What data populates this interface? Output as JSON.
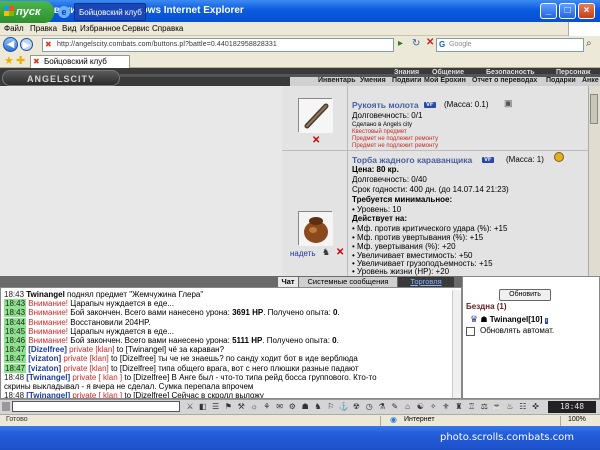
{
  "window": {
    "title": "Бойцовский клуб - Windows Internet Explorer"
  },
  "menu": {
    "items": [
      "Файл",
      "Правка",
      "Вид",
      "Избранное",
      "Сервис",
      "Справка"
    ]
  },
  "address": {
    "url": "http://angelscity.combats.com/buttons.pl?battle=0.440182958828331",
    "search_placeholder": "Google"
  },
  "tab": {
    "label": "Бойцовский клуб"
  },
  "game": {
    "logo": "ANGELSCITY",
    "nav_top": [
      "Знания",
      "Общение",
      "Безопасность",
      "Персонаж"
    ],
    "nav_bottom": [
      "Инвентарь",
      "Умения",
      "Подвиги",
      "Мой Ерохин",
      "Отчет о переводах",
      "Подарки",
      "Анке"
    ]
  },
  "items": [
    {
      "name": "Рукоять молота",
      "badge": "VF",
      "mass": "(Масса: 0.1)",
      "durability": "Долговечность: 0/1",
      "made_in": "Сделано в Angels city",
      "notes": [
        "Квестовый предмет",
        "Предмет не подлежит ремонту",
        "Предмет не подлежит ремонту"
      ]
    },
    {
      "name": "Торба жадного караванщика",
      "badge": "VF",
      "mass": "(Масса: 1)",
      "price": "Цена: 80 кр.",
      "durability": "Долговечность: 0/40",
      "expiry": "Срок годности: 400 дн. (до 14.07.14 21:23)",
      "req_title": "Требуется минимальное:",
      "req_level": "• Уровень: 10",
      "effects_title": "Действует на:",
      "effects": [
        "• Мф. против критического удара (%): +15",
        "• Мф. против увертывания (%): +15",
        "• Мф. увертывания (%): +20",
        "• Увеличивает вместимость: +50",
        "• Увеличивает грузоподъемность: +15",
        "• Уровень жизни (HP): +20"
      ],
      "action": "надеть"
    }
  ],
  "chat_tabs": [
    "Чат",
    "Системные сообщения",
    "Торговля"
  ],
  "chat": [
    {
      "ts": "18:43",
      "hl": false,
      "parts": [
        {
          "t": "Twinangel",
          "c": "bold"
        },
        {
          "t": " поднял предмет \"Жемчужина Глера\"",
          "c": ""
        }
      ]
    },
    {
      "ts": "18:43",
      "hl": true,
      "parts": [
        {
          "t": "Внимание!",
          "c": "warn"
        },
        {
          "t": " Царапыч нуждается в еде...",
          "c": ""
        }
      ]
    },
    {
      "ts": "18:43",
      "hl": true,
      "parts": [
        {
          "t": "Внимание!",
          "c": "warn"
        },
        {
          "t": " Бой закончен. Всего вами нанесено урона: ",
          "c": ""
        },
        {
          "t": "3691 HP",
          "c": "bold"
        },
        {
          "t": ". Получено опыта: ",
          "c": ""
        },
        {
          "t": "0",
          "c": "bold"
        },
        {
          "t": ".",
          "c": ""
        }
      ]
    },
    {
      "ts": "18:44",
      "hl": true,
      "parts": [
        {
          "t": "Внимание!",
          "c": "warn"
        },
        {
          "t": " Восстановили 204HP.",
          "c": ""
        }
      ]
    },
    {
      "ts": "18:45",
      "hl": true,
      "parts": [
        {
          "t": "Внимание!",
          "c": "warn"
        },
        {
          "t": " Царапыч нуждается в еде...",
          "c": ""
        }
      ]
    },
    {
      "ts": "18:46",
      "hl": true,
      "parts": [
        {
          "t": "Внимание!",
          "c": "warn"
        },
        {
          "t": " Бой закончен. Всего вами нанесено урона: ",
          "c": ""
        },
        {
          "t": "5111 HP",
          "c": "bold"
        },
        {
          "t": ". Получено опыта: ",
          "c": ""
        },
        {
          "t": "0",
          "c": "bold"
        },
        {
          "t": ".",
          "c": ""
        }
      ]
    },
    {
      "ts": "18:47",
      "hl": true,
      "parts": [
        {
          "t": "[Dizelfree]",
          "c": "nick"
        },
        {
          "t": " private [klan]",
          "c": "priv"
        },
        {
          "t": " to [Twinangel] чё за караван?",
          "c": ""
        }
      ]
    },
    {
      "ts": "18:47",
      "hl": true,
      "parts": [
        {
          "t": "[vizaton]",
          "c": "nick"
        },
        {
          "t": " private [klan]",
          "c": "priv"
        },
        {
          "t": " to [Dizelfree] ты че не знаешь? по санду ходит бот в иде верблюда",
          "c": ""
        }
      ]
    },
    {
      "ts": "18:47",
      "hl": true,
      "parts": [
        {
          "t": "[vizaton]",
          "c": "nick"
        },
        {
          "t": " private [klan]",
          "c": "priv"
        },
        {
          "t": " to [Dizelfree] типа общего врага, вот с него плюшки разные падают",
          "c": ""
        }
      ]
    },
    {
      "ts": "18:48",
      "hl": false,
      "parts": [
        {
          "t": "[Twinangel]",
          "c": "nick"
        },
        {
          "t": " private [ klan ]",
          "c": "priv"
        },
        {
          "t": " to [Dizelfree] В Анге был - что-то типа рейд босса группового. Кто-то",
          "c": ""
        }
      ]
    },
    {
      "ts": "",
      "hl": false,
      "parts": [
        {
          "t": "скрины выкладывал - я вчера не сделал. Сумка перепала впрочем",
          "c": ""
        }
      ]
    },
    {
      "ts": "18:48",
      "hl": false,
      "parts": [
        {
          "t": "[Twinangel]",
          "c": "nick"
        },
        {
          "t": " private [ klan ]",
          "c": "priv"
        },
        {
          "t": " to [Dizelfree] Сейчас в скролл выложу",
          "c": ""
        }
      ]
    }
  ],
  "right_panel": {
    "refresh": "Обновить",
    "location": "Бездна (1)",
    "user": "Twinangel[10]",
    "auto_label": "Обновлять автомат."
  },
  "status": {
    "text": "Готово",
    "zone": "Интернет",
    "zoom": "100%"
  },
  "taskbar": {
    "start": "пуск",
    "task": "Бойцовский клуб - ...",
    "clock": "18:48"
  },
  "watermark": "photo.scrolls.combats.com"
}
